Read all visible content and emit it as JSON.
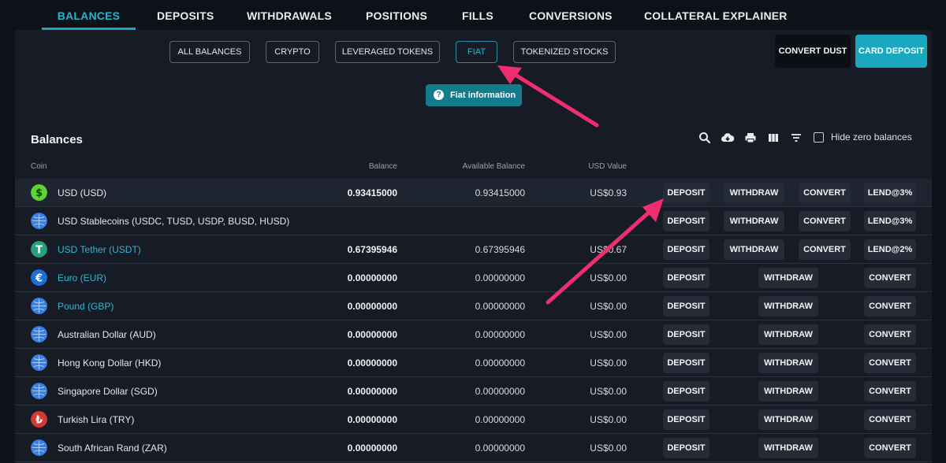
{
  "topnav": {
    "tabs": [
      {
        "label": "BALANCES",
        "active": true
      },
      {
        "label": "DEPOSITS",
        "active": false
      },
      {
        "label": "WITHDRAWALS",
        "active": false
      },
      {
        "label": "POSITIONS",
        "active": false
      },
      {
        "label": "FILLS",
        "active": false
      },
      {
        "label": "CONVERSIONS",
        "active": false
      },
      {
        "label": "COLLATERAL EXPLAINER",
        "active": false
      }
    ]
  },
  "filters": [
    {
      "label": "ALL BALANCES",
      "active": false
    },
    {
      "label": "CRYPTO",
      "active": false
    },
    {
      "label": "LEVERAGED TOKENS",
      "active": false
    },
    {
      "label": "FIAT",
      "active": true
    },
    {
      "label": "TOKENIZED STOCKS",
      "active": false
    }
  ],
  "actions": {
    "convert_dust": "CONVERT DUST",
    "card_deposit": "CARD DEPOSIT"
  },
  "fiat_info": {
    "icon": "question-icon",
    "label": "Fiat information"
  },
  "balances": {
    "title": "Balances",
    "hide_zero_label": "Hide zero balances",
    "hide_zero_checked": false,
    "tools": [
      "search-icon",
      "cloud-download-icon",
      "print-icon",
      "columns-icon",
      "filter-icon"
    ],
    "columns": {
      "coin": "Coin",
      "balance": "Balance",
      "available": "Available Balance",
      "usd": "USD Value"
    },
    "rows": [
      {
        "name": "USD (USD)",
        "link": false,
        "icon": "dollar-icon",
        "balance": "0.93415000",
        "available": "0.93415000",
        "usd": "US$0.93",
        "buttons": [
          "DEPOSIT",
          "WITHDRAW",
          "CONVERT",
          "LEND@3%"
        ]
      },
      {
        "name": "USD Stablecoins (USDC, TUSD, USDP, BUSD, HUSD)",
        "link": false,
        "icon": "globe-icon",
        "balance": "",
        "available": "",
        "usd": "",
        "buttons": [
          "DEPOSIT",
          "WITHDRAW",
          "CONVERT",
          "LEND@3%"
        ]
      },
      {
        "name": "USD Tether (USDT)",
        "link": true,
        "icon": "tether-icon",
        "balance": "0.67395946",
        "available": "0.67395946",
        "usd": "US$0.67",
        "buttons": [
          "DEPOSIT",
          "WITHDRAW",
          "CONVERT",
          "LEND@2%"
        ]
      },
      {
        "name": "Euro (EUR)",
        "link": true,
        "icon": "euro-icon",
        "balance": "0.00000000",
        "available": "0.00000000",
        "usd": "US$0.00",
        "buttons": [
          "DEPOSIT",
          "WITHDRAW",
          "CONVERT"
        ]
      },
      {
        "name": "Pound (GBP)",
        "link": true,
        "icon": "globe-icon",
        "balance": "0.00000000",
        "available": "0.00000000",
        "usd": "US$0.00",
        "buttons": [
          "DEPOSIT",
          "WITHDRAW",
          "CONVERT"
        ]
      },
      {
        "name": "Australian Dollar (AUD)",
        "link": false,
        "icon": "globe-icon",
        "balance": "0.00000000",
        "available": "0.00000000",
        "usd": "US$0.00",
        "buttons": [
          "DEPOSIT",
          "WITHDRAW",
          "CONVERT"
        ]
      },
      {
        "name": "Hong Kong Dollar (HKD)",
        "link": false,
        "icon": "globe-icon",
        "balance": "0.00000000",
        "available": "0.00000000",
        "usd": "US$0.00",
        "buttons": [
          "DEPOSIT",
          "WITHDRAW",
          "CONVERT"
        ]
      },
      {
        "name": "Singapore Dollar (SGD)",
        "link": false,
        "icon": "globe-icon",
        "balance": "0.00000000",
        "available": "0.00000000",
        "usd": "US$0.00",
        "buttons": [
          "DEPOSIT",
          "WITHDRAW",
          "CONVERT"
        ]
      },
      {
        "name": "Turkish Lira (TRY)",
        "link": false,
        "icon": "lira-icon",
        "balance": "0.00000000",
        "available": "0.00000000",
        "usd": "US$0.00",
        "buttons": [
          "DEPOSIT",
          "WITHDRAW",
          "CONVERT"
        ]
      },
      {
        "name": "South African Rand (ZAR)",
        "link": false,
        "icon": "globe-icon",
        "balance": "0.00000000",
        "available": "0.00000000",
        "usd": "US$0.00",
        "buttons": [
          "DEPOSIT",
          "WITHDRAW",
          "CONVERT"
        ]
      }
    ]
  },
  "colors": {
    "accent": "#1aa8c1",
    "arrow": "#ee2e6e",
    "link": "#30b7d1"
  }
}
